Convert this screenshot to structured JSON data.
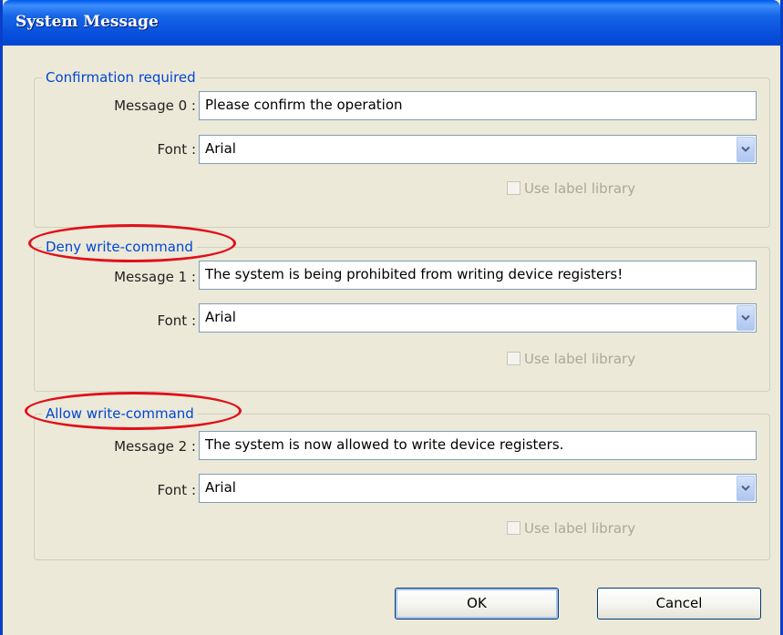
{
  "window": {
    "title": "System Message"
  },
  "groups": [
    {
      "legend": "Confirmation required",
      "message_label": "Message 0 :",
      "message_value": "Please confirm the operation",
      "font_label": "Font :",
      "font_value": "Arial",
      "checkbox_label": "Use label library",
      "checkbox_checked": false,
      "checkbox_enabled": false
    },
    {
      "legend": "Deny write-command",
      "message_label": "Message 1 :",
      "message_value": "The system is being prohibited from writing device registers!",
      "font_label": "Font :",
      "font_value": "Arial",
      "checkbox_label": "Use label library",
      "checkbox_checked": false,
      "checkbox_enabled": false
    },
    {
      "legend": "Allow write-command",
      "message_label": "Message 2 :",
      "message_value": "The system is now allowed to write device registers.",
      "font_label": "Font :",
      "font_value": "Arial",
      "checkbox_label": "Use label library",
      "checkbox_checked": false,
      "checkbox_enabled": false
    }
  ],
  "buttons": {
    "ok_label": "OK",
    "cancel_label": "Cancel"
  },
  "colors": {
    "titlebar": "#0a52dd",
    "legend_text": "#0046d5",
    "highlight_ring": "#e0101a",
    "dialog_background": "#ece9d8"
  },
  "icons": {
    "dropdown": "chevron-down-icon"
  }
}
